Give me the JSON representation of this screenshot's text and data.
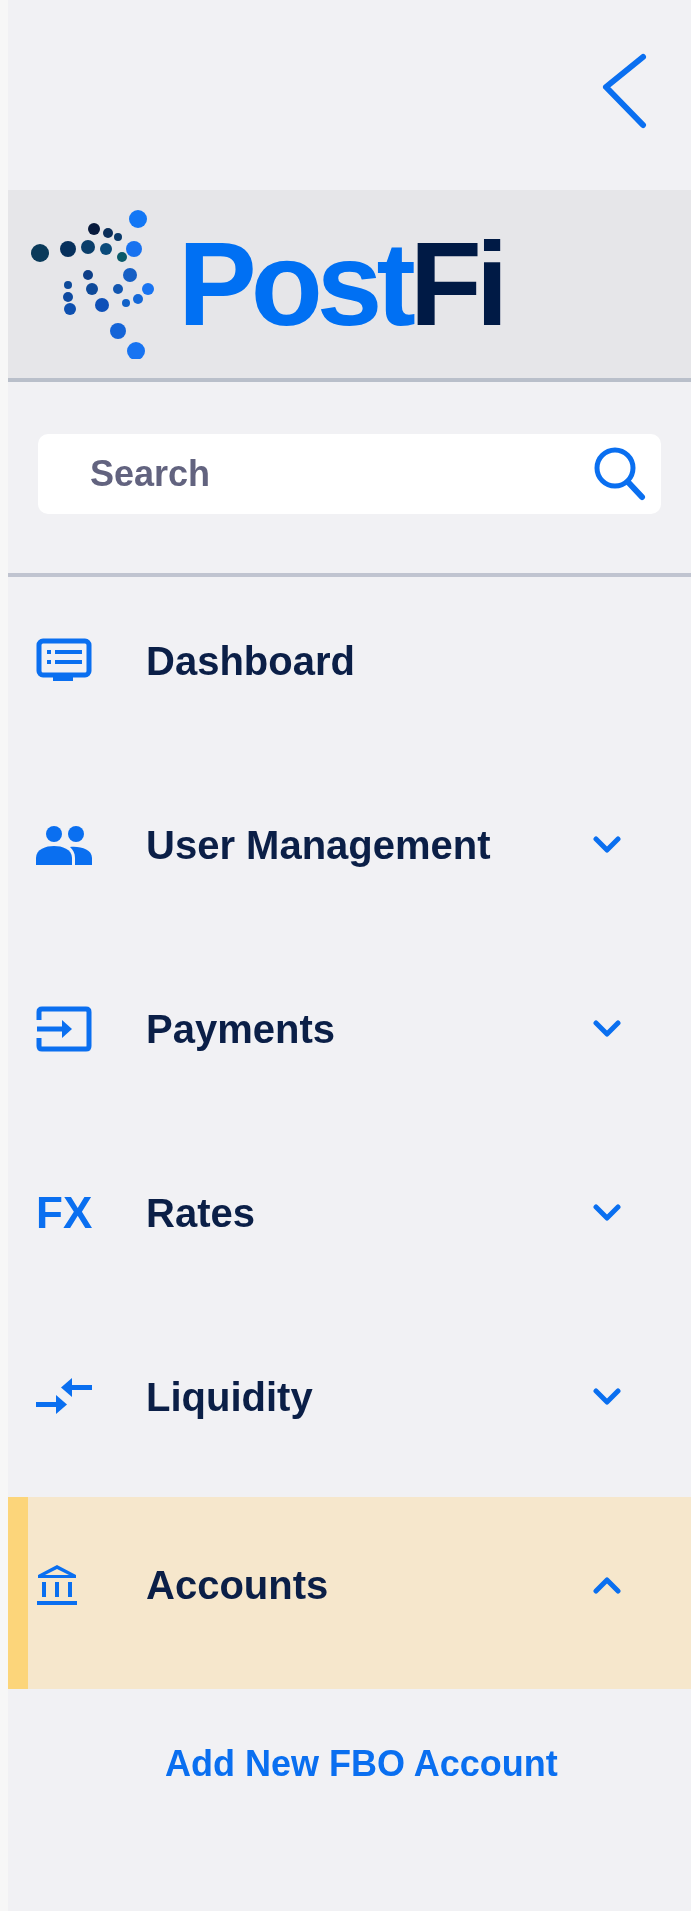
{
  "logo": {
    "part1": "Post",
    "part2": "Fi"
  },
  "search": {
    "placeholder": "Search"
  },
  "menu": [
    {
      "label": "Dashboard",
      "kind": "link",
      "selected": false
    },
    {
      "label": "User Management",
      "kind": "group",
      "expanded": false,
      "selected": false
    },
    {
      "label": "Payments",
      "kind": "group",
      "expanded": false,
      "selected": false
    },
    {
      "label": "Rates",
      "kind": "group",
      "expanded": false,
      "selected": false,
      "icon_text": "FX"
    },
    {
      "label": "Liquidity",
      "kind": "group",
      "expanded": false,
      "selected": false
    },
    {
      "label": "Accounts",
      "kind": "group",
      "expanded": true,
      "selected": true,
      "children": [
        {
          "label": "Add New FBO Account"
        }
      ]
    }
  ]
}
